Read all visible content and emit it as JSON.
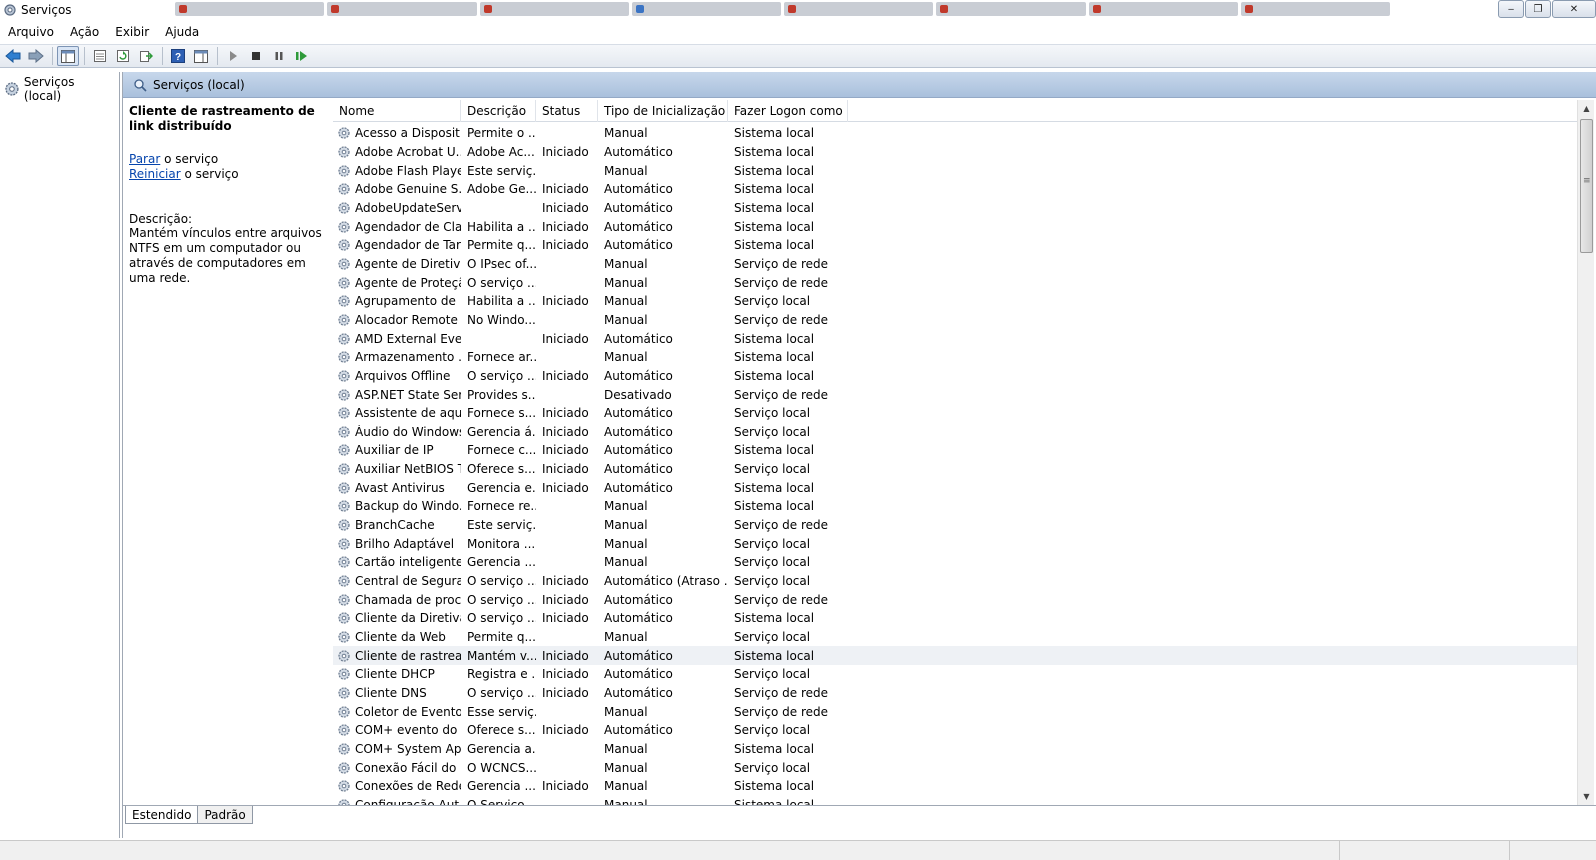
{
  "window": {
    "title": "Serviços",
    "minimize": "‒",
    "maximize": "❐",
    "close": "✕"
  },
  "menu": [
    "Arquivo",
    "Ação",
    "Exibir",
    "Ajuda"
  ],
  "tree": {
    "root_label": "Serviços (local)"
  },
  "pane": {
    "header": "Serviços (local)"
  },
  "detail": {
    "title": "Cliente de rastreamento de link distribuído",
    "stop_link": "Parar",
    "stop_rest": " o serviço",
    "restart_link": "Reiniciar",
    "restart_rest": " o serviço",
    "desc_label": "Descrição:",
    "desc": "Mantém vínculos entre arquivos NTFS em um computador ou através de computadores em uma rede."
  },
  "table": {
    "columns": [
      "Nome",
      "Descrição",
      "Status",
      "Tipo de Inicialização",
      "Fazer Logon como"
    ],
    "sort_indicator": "^",
    "rows": [
      [
        "Acesso a Dispositi...",
        "Permite o ...",
        "",
        "Manual",
        "Sistema local"
      ],
      [
        "Adobe Acrobat U...",
        "Adobe Ac...",
        "Iniciado",
        "Automático",
        "Sistema local"
      ],
      [
        "Adobe Flash Playe...",
        "Este serviç...",
        "",
        "Manual",
        "Sistema local"
      ],
      [
        "Adobe Genuine S...",
        "Adobe Ge...",
        "Iniciado",
        "Automático",
        "Sistema local"
      ],
      [
        "AdobeUpdateServ...",
        "",
        "Iniciado",
        "Automático",
        "Sistema local"
      ],
      [
        "Agendador de Cla...",
        "Habilita a ...",
        "Iniciado",
        "Automático",
        "Sistema local"
      ],
      [
        "Agendador de Tar...",
        "Permite q...",
        "Iniciado",
        "Automático",
        "Sistema local"
      ],
      [
        "Agente de Diretiva...",
        "O IPsec of...",
        "",
        "Manual",
        "Serviço de rede"
      ],
      [
        "Agente de Proteçã...",
        "O serviço ...",
        "",
        "Manual",
        "Serviço de rede"
      ],
      [
        "Agrupamento de ...",
        "Habilita a ...",
        "Iniciado",
        "Manual",
        "Serviço local"
      ],
      [
        "Alocador Remote ...",
        "No Windo...",
        "",
        "Manual",
        "Serviço de rede"
      ],
      [
        "AMD External Eve...",
        "",
        "Iniciado",
        "Automático",
        "Sistema local"
      ],
      [
        "Armazenamento ...",
        "Fornece ar...",
        "",
        "Manual",
        "Sistema local"
      ],
      [
        "Arquivos Offline",
        "O serviço ...",
        "Iniciado",
        "Automático",
        "Sistema local"
      ],
      [
        "ASP.NET State Ser...",
        "Provides s...",
        "",
        "Desativado",
        "Serviço de rede"
      ],
      [
        "Assistente de aqui...",
        "Fornece s...",
        "Iniciado",
        "Automático",
        "Serviço local"
      ],
      [
        "Áudio do Windows",
        "Gerencia á...",
        "Iniciado",
        "Automático",
        "Serviço local"
      ],
      [
        "Auxiliar de IP",
        "Fornece c...",
        "Iniciado",
        "Automático",
        "Sistema local"
      ],
      [
        "Auxiliar NetBIOS T...",
        "Oferece s...",
        "Iniciado",
        "Automático",
        "Serviço local"
      ],
      [
        "Avast Antivirus",
        "Gerencia e...",
        "Iniciado",
        "Automático",
        "Sistema local"
      ],
      [
        "Backup do Windo...",
        "Fornece re...",
        "",
        "Manual",
        "Sistema local"
      ],
      [
        "BranchCache",
        "Este serviç...",
        "",
        "Manual",
        "Serviço de rede"
      ],
      [
        "Brilho Adaptável",
        "Monitora ...",
        "",
        "Manual",
        "Serviço local"
      ],
      [
        "Cartão inteligente",
        "Gerencia ...",
        "",
        "Manual",
        "Serviço local"
      ],
      [
        "Central de Segura...",
        "O serviço ...",
        "Iniciado",
        "Automático (Atraso ...",
        "Serviço local"
      ],
      [
        "Chamada de proc...",
        "O serviço ...",
        "Iniciado",
        "Automático",
        "Serviço de rede"
      ],
      [
        "Cliente da Diretiva...",
        "O serviço ...",
        "Iniciado",
        "Automático",
        "Sistema local"
      ],
      [
        "Cliente da Web",
        "Permite q...",
        "",
        "Manual",
        "Serviço local"
      ],
      [
        "Cliente de rastrea...",
        "Mantém v...",
        "Iniciado",
        "Automático",
        "Sistema local"
      ],
      [
        "Cliente DHCP",
        "Registra e ...",
        "Iniciado",
        "Automático",
        "Serviço local"
      ],
      [
        "Cliente DNS",
        "O serviço ...",
        "Iniciado",
        "Automático",
        "Serviço de rede"
      ],
      [
        "Coletor de Evento...",
        "Esse serviç...",
        "",
        "Manual",
        "Serviço de rede"
      ],
      [
        "COM+ evento do ...",
        "Oferece s...",
        "Iniciado",
        "Automático",
        "Serviço local"
      ],
      [
        "COM+ System Ap...",
        "Gerencia a...",
        "",
        "Manual",
        "Sistema local"
      ],
      [
        "Conexão Fácil do ...",
        "O WCNCS...",
        "",
        "Manual",
        "Serviço local"
      ],
      [
        "Conexões de Rede",
        "Gerencia ...",
        "Iniciado",
        "Manual",
        "Sistema local"
      ],
      [
        "Configuração Aut...",
        "O Serviço ...",
        "",
        "Manual",
        "Sistema local"
      ]
    ],
    "selected_index": 28
  },
  "tabs": [
    "Estendido",
    "Padrão"
  ],
  "active_tab": 0
}
